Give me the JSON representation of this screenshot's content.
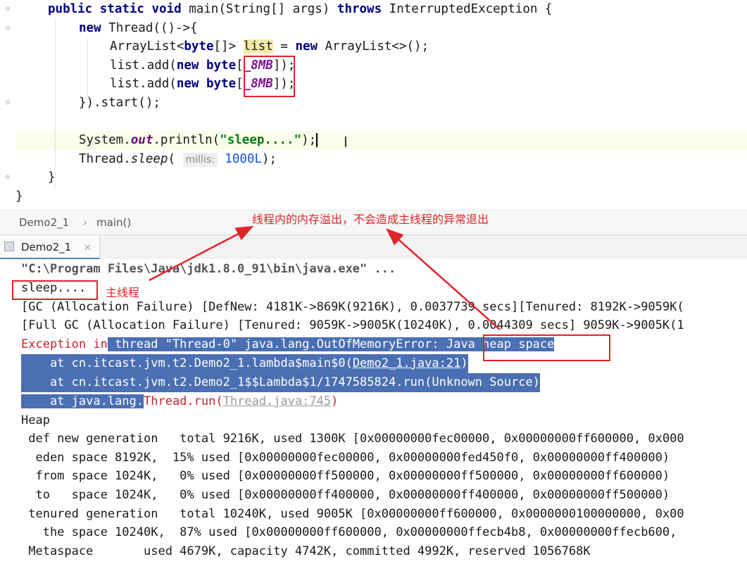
{
  "editor": {
    "lines": [
      {
        "tokens": [
          [
            "kw",
            "public static void "
          ],
          [
            "",
            "main(String[] args) "
          ],
          [
            "kw",
            "throws "
          ],
          [
            "",
            "InterruptedException {"
          ]
        ]
      },
      {
        "tokens": [
          [
            "kw",
            "new "
          ],
          [
            "",
            "Thread(()->{"
          ]
        ]
      },
      {
        "tokens": [
          [
            "",
            "ArrayList<"
          ],
          [
            "kw",
            "byte"
          ],
          [
            "",
            "[]> "
          ],
          [
            "hl",
            "list"
          ],
          [
            "",
            " = "
          ],
          [
            "kw",
            "new "
          ],
          [
            "",
            "ArrayList<>();"
          ]
        ]
      },
      {
        "tokens": [
          [
            "",
            "list.add("
          ],
          [
            "kw",
            "new byte"
          ],
          [
            "",
            "["
          ],
          [
            "const",
            "_8MB"
          ],
          [
            "",
            "]);"
          ]
        ]
      },
      {
        "tokens": [
          [
            "",
            "list.add("
          ],
          [
            "kw",
            "new byte"
          ],
          [
            "",
            "["
          ],
          [
            "const",
            "_8MB"
          ],
          [
            "",
            "]);"
          ]
        ]
      },
      {
        "tokens": [
          [
            "",
            "}).start();"
          ]
        ]
      },
      {
        "tokens": []
      },
      {
        "tokens": [
          [
            "",
            "System."
          ],
          [
            "fld",
            "out"
          ],
          [
            "",
            ".println("
          ],
          [
            "str",
            "\"sleep....\""
          ],
          [
            "",
            ");"
          ],
          [
            "caret",
            ""
          ]
        ]
      },
      {
        "tokens": [
          [
            "",
            "Thread."
          ],
          [
            "stat",
            "sleep"
          ],
          [
            "",
            "( "
          ],
          [
            "hint",
            "millis:"
          ],
          [
            "",
            " "
          ],
          [
            "num",
            "1000L"
          ],
          [
            "",
            ");"
          ]
        ]
      },
      {
        "tokens": [
          [
            "",
            "}"
          ]
        ]
      },
      {
        "tokens": [
          [
            "",
            "}"
          ]
        ]
      }
    ]
  },
  "breadcrumb": {
    "class_name": "Demo2_1",
    "separator": "›",
    "method": "main()"
  },
  "run_tab": {
    "label": "Demo2_1",
    "close": "×"
  },
  "annotations": {
    "thread_oom_note": "线程内的内存溢出，不会造成主线程的异常退出",
    "main_thread_note": "主线程"
  },
  "console": {
    "cmd": "\"C:\\Program Files\\Java\\jdk1.8.0_91\\bin\\java.exe\" ...",
    "sleep": "sleep....",
    "gc1": "[GC (Allocation Failure) [DefNew: 4181K->869K(9216K), 0.0037739 secs][Tenured: 8192K->9059K(",
    "gc2": "[Full GC (Allocation Failure) [Tenured: 9059K->9005K(10240K), 0.0044309 secs] 9059K->9005K(1",
    "exc_prefix": "Exception in",
    "exc_sel": " thread \"Thread-0\" java.lang.OutOfMemoryError: Java heap space",
    "at1_pre": "    at cn.itcast.jvm.t2.Demo2_1.lambda$main$0(",
    "at1_link": "Demo2_1.java:21",
    "at1_post": ")",
    "at2": "    at cn.itcast.jvm.t2.Demo2_1$$Lambda$1/1747585824.run(Unknown Source)",
    "at3_sel": "    at java.lang.",
    "at3_rest": "Thread.run(",
    "at3_link": "Thread.java:745",
    "at3_post": ")",
    "heap": "Heap",
    "h1": " def new generation   total 9216K, used 1300K [0x00000000fec00000, 0x00000000ff600000, 0x000",
    "h2": "  eden space 8192K,  15% used [0x00000000fec00000, 0x00000000fed450f0, 0x00000000ff400000)",
    "h3": "  from space 1024K,   0% used [0x00000000ff500000, 0x00000000ff500000, 0x00000000ff600000)",
    "h4": "  to   space 1024K,   0% used [0x00000000ff400000, 0x00000000ff400000, 0x00000000ff500000)",
    "h5": " tenured generation   total 10240K, used 9005K [0x00000000ff600000, 0x0000000100000000, 0x00",
    "h6": "   the space 10240K,  87% used [0x00000000ff600000, 0x00000000ffecb4b8, 0x00000000ffecb600,",
    "h7": " Metaspace       used 4679K, capacity 4742K, committed 4992K, reserved 1056768K"
  },
  "colors": {
    "annotation_red": "#e0242a",
    "selection_blue": "#4a6fb3",
    "keyword_navy": "#000080"
  },
  "icons": [
    "fold-marker-icon",
    "tab-console-icon",
    "text-cursor-icon",
    "arrow-icon"
  ]
}
